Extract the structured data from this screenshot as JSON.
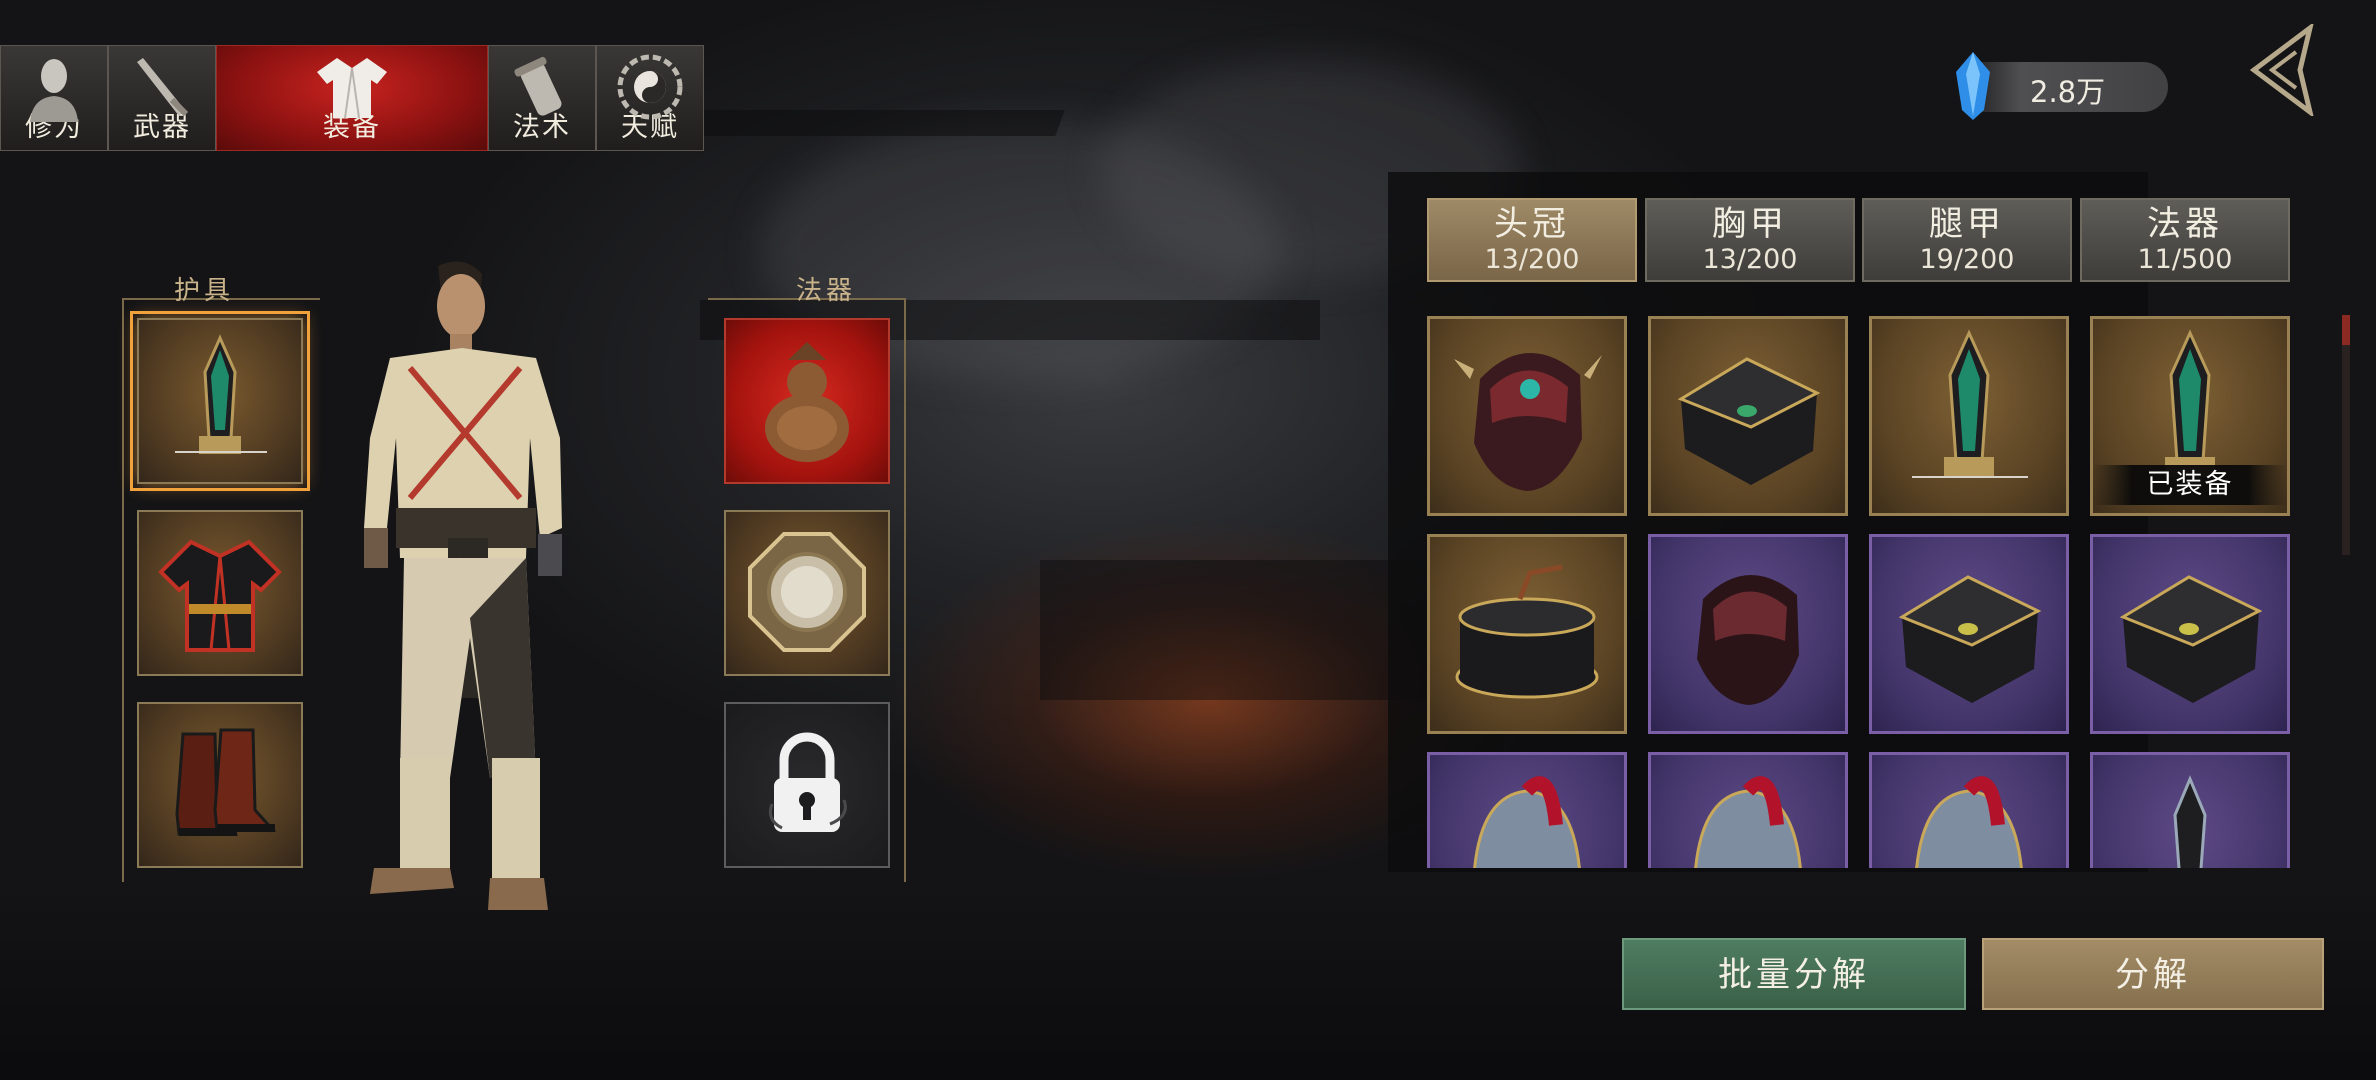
{
  "nav_tabs": [
    {
      "label": "修为",
      "icon": "cultivation-bust-icon",
      "active": false
    },
    {
      "label": "武器",
      "icon": "sword-icon",
      "active": false
    },
    {
      "label": "装备",
      "icon": "robe-icon",
      "active": true
    },
    {
      "label": "法术",
      "icon": "scroll-icon",
      "active": false
    },
    {
      "label": "天赋",
      "icon": "bagua-icon",
      "active": false
    }
  ],
  "currency": {
    "value": "2.8万",
    "icon": "spirit-crystal-icon"
  },
  "left_panel": {
    "armor_title": "护具",
    "artifact_title": "法器",
    "armor_slots": [
      {
        "icon": "dagger-icon",
        "selected": true
      },
      {
        "icon": "robe-armor-icon",
        "selected": false
      },
      {
        "icon": "boots-icon",
        "selected": false
      }
    ],
    "artifact_slots": [
      {
        "icon": "gourd-icon",
        "state": "equipped-red"
      },
      {
        "icon": "bagua-mirror-icon",
        "state": "equipped"
      },
      {
        "icon": "lock-icon",
        "state": "locked"
      }
    ]
  },
  "category_tabs": [
    {
      "name": "头冠",
      "count": "13/200",
      "active": true
    },
    {
      "name": "胸甲",
      "count": "13/200",
      "active": false
    },
    {
      "name": "腿甲",
      "count": "19/200",
      "active": false
    },
    {
      "name": "法器",
      "count": "11/500",
      "active": false
    }
  ],
  "inventory": [
    {
      "icon": "demon-helmet-icon",
      "rarity": "gold"
    },
    {
      "icon": "black-hood-icon",
      "rarity": "gold"
    },
    {
      "icon": "dagger-icon",
      "rarity": "gold"
    },
    {
      "icon": "dagger-icon",
      "rarity": "gold",
      "tag": "已装备"
    },
    {
      "icon": "scholar-hat-icon",
      "rarity": "gold"
    },
    {
      "icon": "demon-helmet-icon",
      "rarity": "purple"
    },
    {
      "icon": "black-hood-icon",
      "rarity": "purple"
    },
    {
      "icon": "black-hood-icon",
      "rarity": "purple"
    },
    {
      "icon": "plumed-helmet-icon",
      "rarity": "purple"
    },
    {
      "icon": "plumed-helmet-icon",
      "rarity": "purple"
    },
    {
      "icon": "plumed-helmet-icon",
      "rarity": "purple"
    },
    {
      "icon": "dagger-icon",
      "rarity": "purple"
    }
  ],
  "buttons": {
    "batch_decompose": "批量分解",
    "decompose": "分解"
  },
  "colors": {
    "gold_rarity": "#9a8154",
    "purple_rarity": "#7b5fa6",
    "active_tab_red": "#c8231f",
    "batch_button": "#4f7d62",
    "decompose_button": "#a38c66"
  }
}
